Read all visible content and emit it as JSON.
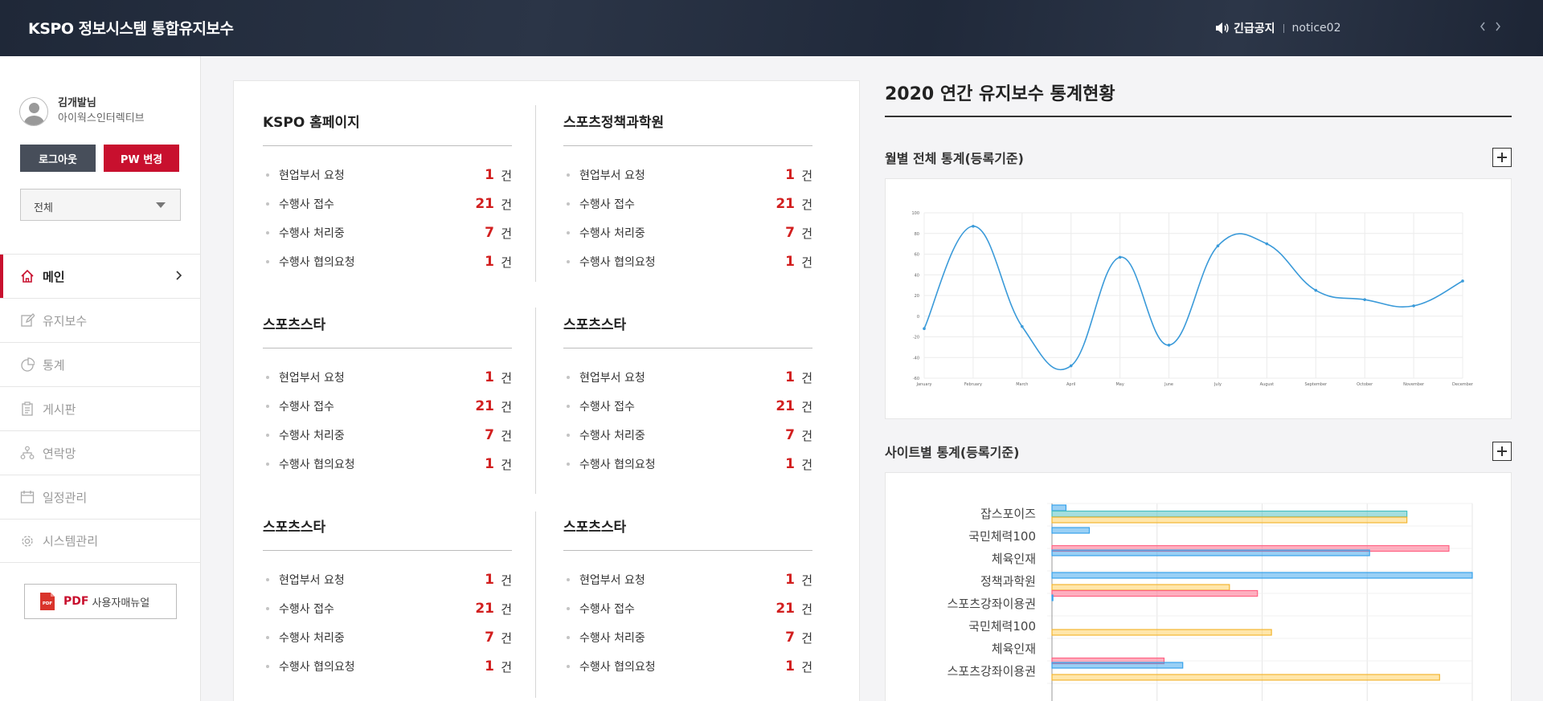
{
  "header": {
    "brand": "KSPO 정보시스템 통합유지보수",
    "notice_label": "긴급공지",
    "notice_text": "notice02",
    "icons": {
      "speaker": "speaker-icon",
      "prev": "chevron-left-icon",
      "next": "chevron-right-icon"
    }
  },
  "profile": {
    "name": "김개발님",
    "org": "아이웍스인터렉티브"
  },
  "buttons": {
    "logout": "로그아웃",
    "pw_change": "PW 변경"
  },
  "filter": {
    "selected": "전체"
  },
  "nav": {
    "items": [
      {
        "label": "메인",
        "icon": "home-icon",
        "active": true
      },
      {
        "label": "유지보수",
        "icon": "edit-icon",
        "active": false
      },
      {
        "label": "통계",
        "icon": "pie-chart-icon",
        "active": false
      },
      {
        "label": "게시판",
        "icon": "clipboard-icon",
        "active": false
      },
      {
        "label": "연락망",
        "icon": "network-icon",
        "active": false
      },
      {
        "label": "일정관리",
        "icon": "calendar-icon",
        "active": false
      },
      {
        "label": "시스템관리",
        "icon": "gear-icon",
        "active": false
      }
    ]
  },
  "pdf": {
    "strong": "PDF",
    "label": "사용자매뉴얼",
    "icon_text": "PDF"
  },
  "groups": [
    {
      "title": "KSPO 홈페이지",
      "rows": [
        {
          "label": "현업부서 요청",
          "value": "1",
          "unit": "건"
        },
        {
          "label": "수행사 접수",
          "value": "21",
          "unit": "건"
        },
        {
          "label": "수행사 처리중",
          "value": "7",
          "unit": "건"
        },
        {
          "label": "수행사 협의요청",
          "value": "1",
          "unit": "건"
        }
      ]
    },
    {
      "title": "스포츠정책과학원",
      "rows": [
        {
          "label": "현업부서 요청",
          "value": "1",
          "unit": "건"
        },
        {
          "label": "수행사 접수",
          "value": "21",
          "unit": "건"
        },
        {
          "label": "수행사 처리중",
          "value": "7",
          "unit": "건"
        },
        {
          "label": "수행사 협의요청",
          "value": "1",
          "unit": "건"
        }
      ]
    },
    {
      "title": "스포츠스타",
      "rows": [
        {
          "label": "현업부서 요청",
          "value": "1",
          "unit": "건"
        },
        {
          "label": "수행사 접수",
          "value": "21",
          "unit": "건"
        },
        {
          "label": "수행사 처리중",
          "value": "7",
          "unit": "건"
        },
        {
          "label": "수행사 협의요청",
          "value": "1",
          "unit": "건"
        }
      ]
    },
    {
      "title": "스포츠스타",
      "rows": [
        {
          "label": "현업부서 요청",
          "value": "1",
          "unit": "건"
        },
        {
          "label": "수행사 접수",
          "value": "21",
          "unit": "건"
        },
        {
          "label": "수행사 처리중",
          "value": "7",
          "unit": "건"
        },
        {
          "label": "수행사 협의요청",
          "value": "1",
          "unit": "건"
        }
      ]
    },
    {
      "title": "스포츠스타",
      "rows": [
        {
          "label": "현업부서 요청",
          "value": "1",
          "unit": "건"
        },
        {
          "label": "수행사 접수",
          "value": "21",
          "unit": "건"
        },
        {
          "label": "수행사 처리중",
          "value": "7",
          "unit": "건"
        },
        {
          "label": "수행사 협의요청",
          "value": "1",
          "unit": "건"
        }
      ]
    },
    {
      "title": "스포츠스타",
      "rows": [
        {
          "label": "현업부서 요청",
          "value": "1",
          "unit": "건"
        },
        {
          "label": "수행사 접수",
          "value": "21",
          "unit": "건"
        },
        {
          "label": "수행사 처리중",
          "value": "7",
          "unit": "건"
        },
        {
          "label": "수행사 협의요청",
          "value": "1",
          "unit": "건"
        }
      ]
    }
  ],
  "stats": {
    "title": "2020 연간 유지보수 통계현황",
    "monthly_title": "월별 전체 통계(등록기준)",
    "site_title": "사이트별 통계(등록기준)"
  },
  "colors": {
    "accent": "#c8102e",
    "line": "#3a9ad9",
    "blue": "#36a2eb",
    "teal": "#4bc0c0",
    "yellow": "#ffcd56",
    "pink": "#ff6384"
  },
  "chart_data": [
    {
      "type": "line",
      "categories": [
        "January",
        "February",
        "March",
        "April",
        "May",
        "June",
        "July",
        "August",
        "September",
        "October",
        "November",
        "December"
      ],
      "series": [
        {
          "values": [
            -12,
            87,
            -10,
            -48,
            57,
            -28,
            68,
            70,
            25,
            16,
            10,
            34
          ]
        }
      ],
      "ylim": [
        -60,
        100
      ],
      "yticks": [
        100,
        80,
        60,
        40,
        20,
        0,
        -20,
        -40,
        -60
      ],
      "grid": true,
      "curve": "smooth"
    },
    {
      "type": "bar",
      "orientation": "horizontal",
      "categories": [
        "잡스포이즈",
        "국민체력100",
        "체육인재",
        "정책과학원",
        "스포츠강좌이용권",
        "국민체력100",
        "체육인재",
        "스포츠강좌이용권"
      ],
      "series": [
        {
          "color": "blue",
          "values": [
            3,
            8,
            68,
            90,
            0.2,
            0,
            0,
            28
          ]
        },
        {
          "color": "teal",
          "values": [
            76,
            0,
            0,
            0,
            0,
            0,
            0,
            0
          ]
        },
        {
          "color": "yellow",
          "values": [
            76,
            0,
            0,
            38,
            0,
            47,
            0,
            83
          ]
        },
        {
          "color": "pink",
          "values": [
            0,
            85,
            0,
            44,
            0,
            0,
            24,
            0
          ]
        }
      ],
      "xlim": [
        0,
        90
      ],
      "grid": true
    }
  ]
}
